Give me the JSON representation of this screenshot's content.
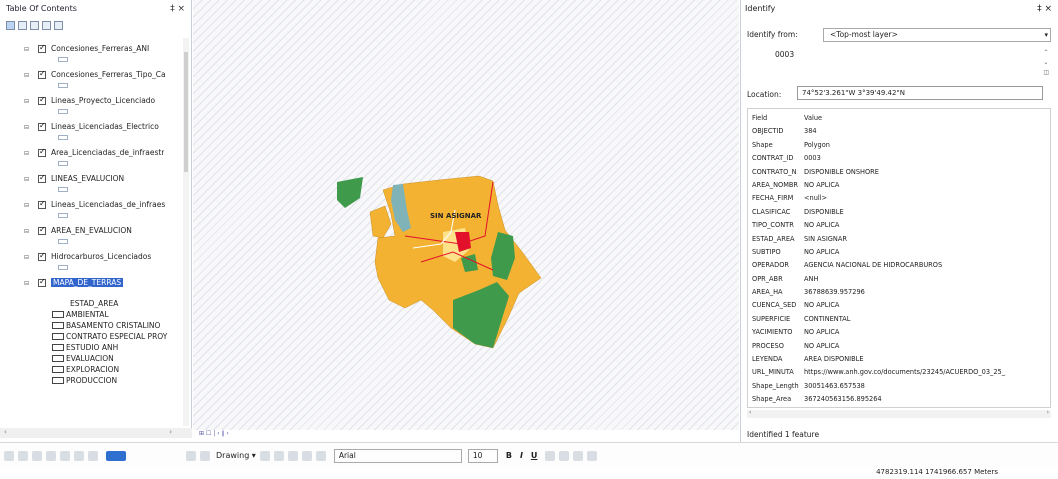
{
  "toc": {
    "title": "Table Of Contents",
    "pin_label": "‡ ×",
    "layers": [
      {
        "name": "Concesiones_Ferreras_ANI"
      },
      {
        "name": "Concesiones_Ferreras_Tipo_Ca"
      },
      {
        "name": "Lineas_Proyecto_Licenciado"
      },
      {
        "name": "Lineas_Licenciadas_Electrico"
      },
      {
        "name": "Area_Licenciadas_de_infraestr"
      },
      {
        "name": "LINEAS_EVALUCION"
      },
      {
        "name": "Lineas_Licenciadas_de_infraes"
      },
      {
        "name": "AREA_EN_EVALUCION"
      },
      {
        "name": "Hidrocarburos_Licenciados"
      },
      {
        "name": "MAPA_DE_TERRAS"
      }
    ],
    "legend_field": "ESTAD_AREA",
    "legend": [
      "AMBIENTAL",
      "BASAMENTO CRISTALINO",
      "CONTRATO ESPECIAL PROY",
      "ESTUDIO ANH",
      "EVALUACION",
      "EXPLORACION",
      "PRODUCCION"
    ]
  },
  "map": {
    "label": "SIN ASIGNAR",
    "nav_text": "⊞ ☐ | ‹ ∥ ›"
  },
  "identify": {
    "title": "Identify",
    "pin_label": "‡ ×",
    "from_label": "Identify from:",
    "from_value": "<Top-most layer>",
    "tree_item": "0003",
    "location_label": "Location:",
    "location_value": "74°52'3.261\"W  3°39'49.42\"N",
    "fields_header": {
      "field": "Field",
      "value": "Value"
    },
    "attributes": [
      {
        "k": "OBJECTID",
        "v": "384"
      },
      {
        "k": "Shape",
        "v": "Polygon"
      },
      {
        "k": "CONTRAT_ID",
        "v": "0003"
      },
      {
        "k": "CONTRATO_N",
        "v": "DISPONIBLE ONSHORE"
      },
      {
        "k": "AREA_NOMBR",
        "v": "NO APLICA"
      },
      {
        "k": "FECHA_FIRM",
        "v": "<null>"
      },
      {
        "k": "CLASIFICAC",
        "v": "DISPONIBLE"
      },
      {
        "k": "TIPO_CONTR",
        "v": "NO APLICA"
      },
      {
        "k": "ESTAD_AREA",
        "v": "SIN ASIGNAR"
      },
      {
        "k": "SUBTIPO",
        "v": "NO APLICA"
      },
      {
        "k": "OPERADOR",
        "v": "AGENCIA NACIONAL DE HIDROCARBUROS"
      },
      {
        "k": "OPR_ABR",
        "v": "ANH"
      },
      {
        "k": "AREA_HA",
        "v": "36788639.957296"
      },
      {
        "k": "CUENCA_SED",
        "v": "NO APLICA"
      },
      {
        "k": "SUPERFICIE",
        "v": "CONTINENTAL"
      },
      {
        "k": "YACIMIENTO",
        "v": "NO APLICA"
      },
      {
        "k": "PROCESO",
        "v": "NO APLICA"
      },
      {
        "k": "LEYENDA",
        "v": "AREA DISPONIBLE"
      },
      {
        "k": "URL_MINUTA",
        "v": "https://www.anh.gov.co/documents/23245/ACUERDO_03_25_"
      },
      {
        "k": "Shape_Length",
        "v": "30051463.657538"
      },
      {
        "k": "Shape_Area",
        "v": "367240563156.895264"
      }
    ],
    "status": "Identified 1 feature"
  },
  "toolbar": {
    "drawing_label": "Drawing ▾",
    "font_name": "Arial",
    "font_size": "10",
    "bold": "B",
    "italic": "I",
    "underline": "U"
  },
  "statusbar": {
    "coords": "4782319.114  1741966.657 Meters"
  },
  "colors": {
    "orange": "#f4b233",
    "green": "#3f9a4b",
    "teal": "#7fb3b8",
    "red": "#e3102c",
    "highlight": "#3366cc"
  }
}
